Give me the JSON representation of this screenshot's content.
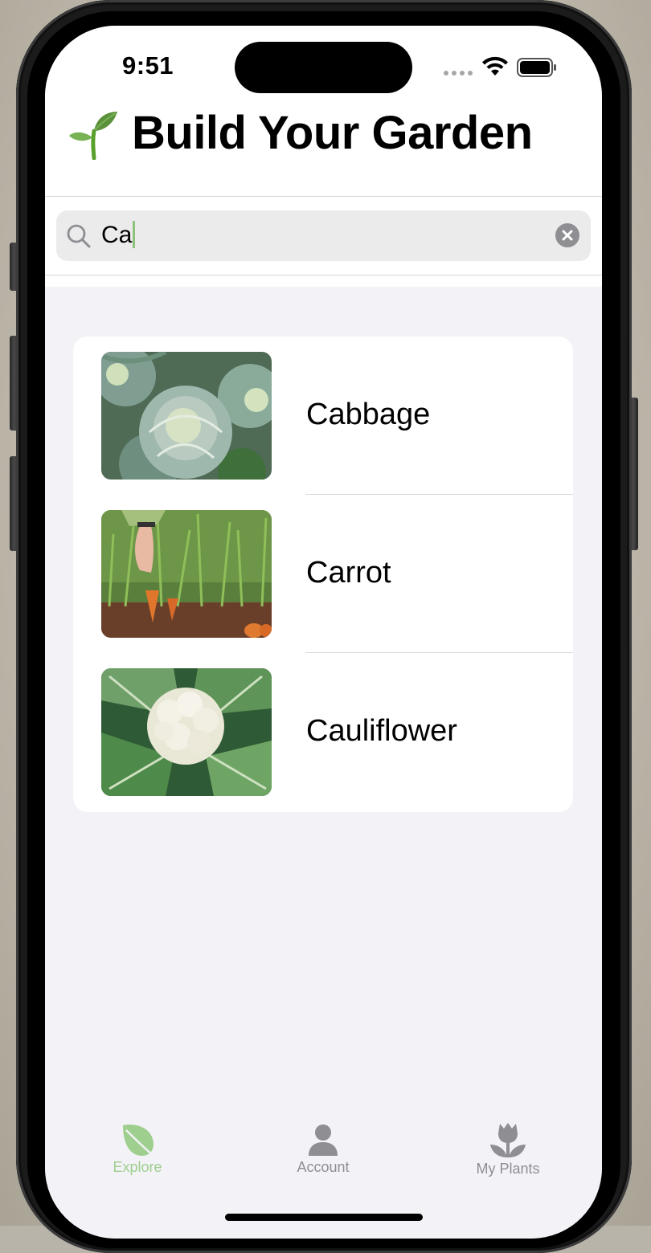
{
  "status_bar": {
    "time": "9:51"
  },
  "header": {
    "title": "Build Your Garden",
    "icon": "sprout-icon"
  },
  "search": {
    "value": "Ca",
    "clear_icon": "clear-icon"
  },
  "results": [
    {
      "label": "Cabbage",
      "image": "cabbage-photo"
    },
    {
      "label": "Carrot",
      "image": "carrot-photo"
    },
    {
      "label": "Cauliflower",
      "image": "cauliflower-photo"
    }
  ],
  "tabs": [
    {
      "label": "Explore",
      "icon": "leaf-icon",
      "selected": true
    },
    {
      "label": "Account",
      "icon": "person-icon",
      "selected": false
    },
    {
      "label": "My Plants",
      "icon": "tulip-icon",
      "selected": false
    }
  ],
  "colors": {
    "accent": "#9fcf8e",
    "tab_inactive": "#8e8e93",
    "background": "#f2f2f7"
  }
}
